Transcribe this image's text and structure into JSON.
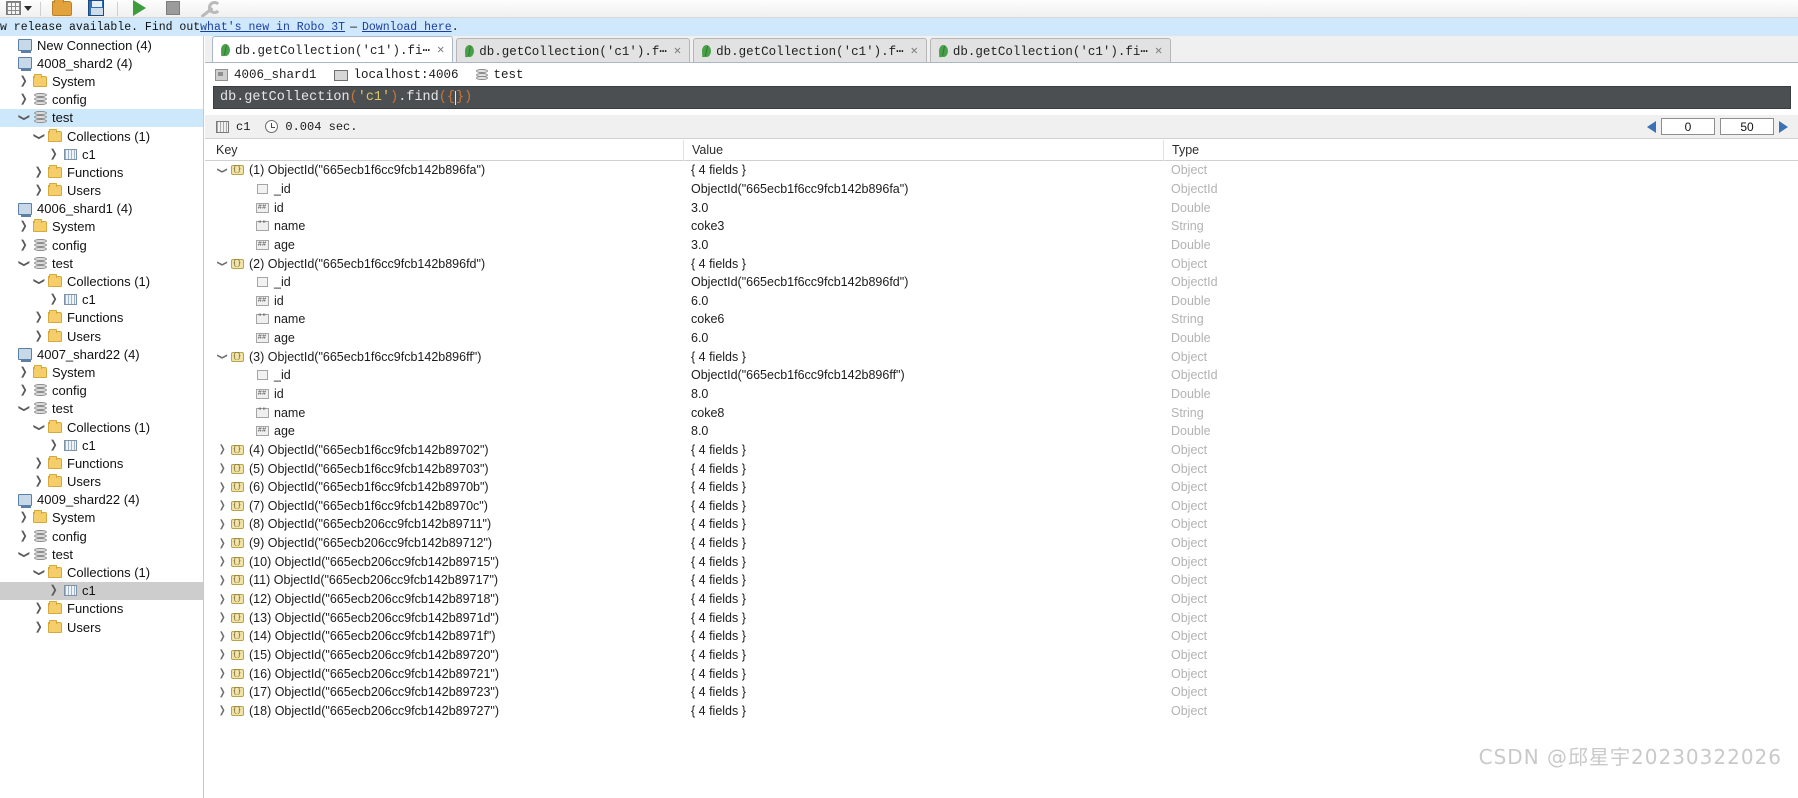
{
  "toolbar": {
    "buttons": [
      {
        "name": "grid-dropdown",
        "icon": "grid-icon"
      },
      {
        "name": "open-file",
        "icon": "folder-icon"
      },
      {
        "name": "save-file",
        "icon": "save-icon"
      },
      {
        "name": "execute-query",
        "icon": "play-icon"
      },
      {
        "name": "stop-query",
        "icon": "stop-icon"
      },
      {
        "name": "settings",
        "icon": "wrench-icon"
      }
    ]
  },
  "notification": {
    "prefix": "w release available. Find out ",
    "link1": "what's new in Robo 3T",
    "dash": "—",
    "link2": "Download here",
    "suffix": ".",
    "background": "#cfe8fb"
  },
  "sidebar": {
    "items": [
      {
        "label": "New Connection (4)",
        "icon": "server-icon",
        "depth": 0,
        "twisty": "none",
        "selected": false
      },
      {
        "label": "4008_shard2 (4)",
        "icon": "server-icon",
        "depth": 0,
        "twisty": "none",
        "selected": false
      },
      {
        "label": "System",
        "icon": "folder-icon",
        "depth": 1,
        "twisty": "closed",
        "selected": false
      },
      {
        "label": "config",
        "icon": "database-icon",
        "depth": 1,
        "twisty": "closed",
        "selected": false
      },
      {
        "label": "test",
        "icon": "database-icon",
        "depth": 1,
        "twisty": "open",
        "selected": true
      },
      {
        "label": "Collections (1)",
        "icon": "folder-icon",
        "depth": 2,
        "twisty": "open",
        "selected": false
      },
      {
        "label": "c1",
        "icon": "collection-icon",
        "depth": 3,
        "twisty": "closed",
        "selected": false
      },
      {
        "label": "Functions",
        "icon": "folder-icon",
        "depth": 2,
        "twisty": "closed",
        "selected": false
      },
      {
        "label": "Users",
        "icon": "folder-icon",
        "depth": 2,
        "twisty": "closed",
        "selected": false
      },
      {
        "label": "4006_shard1 (4)",
        "icon": "server-icon",
        "depth": 0,
        "twisty": "none",
        "selected": false
      },
      {
        "label": "System",
        "icon": "folder-icon",
        "depth": 1,
        "twisty": "closed",
        "selected": false
      },
      {
        "label": "config",
        "icon": "database-icon",
        "depth": 1,
        "twisty": "closed",
        "selected": false
      },
      {
        "label": "test",
        "icon": "database-icon",
        "depth": 1,
        "twisty": "open",
        "selected": false
      },
      {
        "label": "Collections (1)",
        "icon": "folder-icon",
        "depth": 2,
        "twisty": "open",
        "selected": false
      },
      {
        "label": "c1",
        "icon": "collection-icon",
        "depth": 3,
        "twisty": "closed",
        "selected": false
      },
      {
        "label": "Functions",
        "icon": "folder-icon",
        "depth": 2,
        "twisty": "closed",
        "selected": false
      },
      {
        "label": "Users",
        "icon": "folder-icon",
        "depth": 2,
        "twisty": "closed",
        "selected": false
      },
      {
        "label": "4007_shard22 (4)",
        "icon": "server-icon",
        "depth": 0,
        "twisty": "none",
        "selected": false
      },
      {
        "label": "System",
        "icon": "folder-icon",
        "depth": 1,
        "twisty": "closed",
        "selected": false
      },
      {
        "label": "config",
        "icon": "database-icon",
        "depth": 1,
        "twisty": "closed",
        "selected": false
      },
      {
        "label": "test",
        "icon": "database-icon",
        "depth": 1,
        "twisty": "open",
        "selected": false
      },
      {
        "label": "Collections (1)",
        "icon": "folder-icon",
        "depth": 2,
        "twisty": "open",
        "selected": false
      },
      {
        "label": "c1",
        "icon": "collection-icon",
        "depth": 3,
        "twisty": "closed",
        "selected": false
      },
      {
        "label": "Functions",
        "icon": "folder-icon",
        "depth": 2,
        "twisty": "closed",
        "selected": false
      },
      {
        "label": "Users",
        "icon": "folder-icon",
        "depth": 2,
        "twisty": "closed",
        "selected": false
      },
      {
        "label": "4009_shard22 (4)",
        "icon": "server-icon",
        "depth": 0,
        "twisty": "none",
        "selected": false
      },
      {
        "label": "System",
        "icon": "folder-icon",
        "depth": 1,
        "twisty": "closed",
        "selected": false
      },
      {
        "label": "config",
        "icon": "database-icon",
        "depth": 1,
        "twisty": "closed",
        "selected": false
      },
      {
        "label": "test",
        "icon": "database-icon",
        "depth": 1,
        "twisty": "open",
        "selected": false
      },
      {
        "label": "Collections (1)",
        "icon": "folder-icon",
        "depth": 2,
        "twisty": "open",
        "selected": false
      },
      {
        "label": "c1",
        "icon": "collection-icon",
        "depth": 3,
        "twisty": "closed",
        "selected": "gray"
      },
      {
        "label": "Functions",
        "icon": "folder-icon",
        "depth": 2,
        "twisty": "closed",
        "selected": false
      },
      {
        "label": "Users",
        "icon": "folder-icon",
        "depth": 2,
        "twisty": "closed",
        "selected": false
      }
    ]
  },
  "tabs": [
    {
      "label": "db.getCollection('c1').fi⋯",
      "active": true,
      "close": "✕"
    },
    {
      "label": "db.getCollection('c1').f⋯",
      "active": false,
      "close": "✕"
    },
    {
      "label": "db.getCollection('c1').f⋯",
      "active": false,
      "close": "✕"
    },
    {
      "label": "db.getCollection('c1').fi⋯",
      "active": false,
      "close": "✕"
    }
  ],
  "breadcrumb": {
    "shard": "4006_shard1",
    "host": "localhost:4006",
    "database": "test"
  },
  "editor": {
    "part_db": "db.getCollection",
    "part_open": "(",
    "part_str": "'c1'",
    "part_close": ")",
    "part_find": ".find",
    "part_paren_open": "(",
    "part_brace_open": "{",
    "part_brace_close": "}",
    "part_paren_close": ")",
    "full_text": "db.getCollection('c1').find({})"
  },
  "result_bar": {
    "collection": "c1",
    "time": "0.004 sec.",
    "page_start": "0",
    "page_size": "50"
  },
  "grid": {
    "columns": [
      "Key",
      "Value",
      "Type"
    ],
    "rows": [
      {
        "indent": 0,
        "twisty": "open",
        "icon": "object-icon",
        "key": "(1) ObjectId(\"665ecb1f6cc9fcb142b896fa\")",
        "value": "{ 4 fields }",
        "type": "Object"
      },
      {
        "indent": 1,
        "twisty": "none",
        "icon": "objectid-icon",
        "key": "_id",
        "value": "ObjectId(\"665ecb1f6cc9fcb142b896fa\")",
        "type": "ObjectId"
      },
      {
        "indent": 1,
        "twisty": "none",
        "icon": "number-icon",
        "key": "id",
        "value": "3.0",
        "type": "Double"
      },
      {
        "indent": 1,
        "twisty": "none",
        "icon": "string-icon",
        "key": "name",
        "value": "coke3",
        "type": "String"
      },
      {
        "indent": 1,
        "twisty": "none",
        "icon": "number-icon",
        "key": "age",
        "value": "3.0",
        "type": "Double"
      },
      {
        "indent": 0,
        "twisty": "open",
        "icon": "object-icon",
        "key": "(2) ObjectId(\"665ecb1f6cc9fcb142b896fd\")",
        "value": "{ 4 fields }",
        "type": "Object"
      },
      {
        "indent": 1,
        "twisty": "none",
        "icon": "objectid-icon",
        "key": "_id",
        "value": "ObjectId(\"665ecb1f6cc9fcb142b896fd\")",
        "type": "ObjectId"
      },
      {
        "indent": 1,
        "twisty": "none",
        "icon": "number-icon",
        "key": "id",
        "value": "6.0",
        "type": "Double"
      },
      {
        "indent": 1,
        "twisty": "none",
        "icon": "string-icon",
        "key": "name",
        "value": "coke6",
        "type": "String"
      },
      {
        "indent": 1,
        "twisty": "none",
        "icon": "number-icon",
        "key": "age",
        "value": "6.0",
        "type": "Double"
      },
      {
        "indent": 0,
        "twisty": "open",
        "icon": "object-icon",
        "key": "(3) ObjectId(\"665ecb1f6cc9fcb142b896ff\")",
        "value": "{ 4 fields }",
        "type": "Object"
      },
      {
        "indent": 1,
        "twisty": "none",
        "icon": "objectid-icon",
        "key": "_id",
        "value": "ObjectId(\"665ecb1f6cc9fcb142b896ff\")",
        "type": "ObjectId"
      },
      {
        "indent": 1,
        "twisty": "none",
        "icon": "number-icon",
        "key": "id",
        "value": "8.0",
        "type": "Double"
      },
      {
        "indent": 1,
        "twisty": "none",
        "icon": "string-icon",
        "key": "name",
        "value": "coke8",
        "type": "String"
      },
      {
        "indent": 1,
        "twisty": "none",
        "icon": "number-icon",
        "key": "age",
        "value": "8.0",
        "type": "Double"
      },
      {
        "indent": 0,
        "twisty": "closed",
        "icon": "object-icon",
        "key": "(4) ObjectId(\"665ecb1f6cc9fcb142b89702\")",
        "value": "{ 4 fields }",
        "type": "Object"
      },
      {
        "indent": 0,
        "twisty": "closed",
        "icon": "object-icon",
        "key": "(5) ObjectId(\"665ecb1f6cc9fcb142b89703\")",
        "value": "{ 4 fields }",
        "type": "Object"
      },
      {
        "indent": 0,
        "twisty": "closed",
        "icon": "object-icon",
        "key": "(6) ObjectId(\"665ecb1f6cc9fcb142b8970b\")",
        "value": "{ 4 fields }",
        "type": "Object"
      },
      {
        "indent": 0,
        "twisty": "closed",
        "icon": "object-icon",
        "key": "(7) ObjectId(\"665ecb1f6cc9fcb142b8970c\")",
        "value": "{ 4 fields }",
        "type": "Object"
      },
      {
        "indent": 0,
        "twisty": "closed",
        "icon": "object-icon",
        "key": "(8) ObjectId(\"665ecb206cc9fcb142b89711\")",
        "value": "{ 4 fields }",
        "type": "Object"
      },
      {
        "indent": 0,
        "twisty": "closed",
        "icon": "object-icon",
        "key": "(9) ObjectId(\"665ecb206cc9fcb142b89712\")",
        "value": "{ 4 fields }",
        "type": "Object"
      },
      {
        "indent": 0,
        "twisty": "closed",
        "icon": "object-icon",
        "key": "(10) ObjectId(\"665ecb206cc9fcb142b89715\")",
        "value": "{ 4 fields }",
        "type": "Object"
      },
      {
        "indent": 0,
        "twisty": "closed",
        "icon": "object-icon",
        "key": "(11) ObjectId(\"665ecb206cc9fcb142b89717\")",
        "value": "{ 4 fields }",
        "type": "Object"
      },
      {
        "indent": 0,
        "twisty": "closed",
        "icon": "object-icon",
        "key": "(12) ObjectId(\"665ecb206cc9fcb142b89718\")",
        "value": "{ 4 fields }",
        "type": "Object"
      },
      {
        "indent": 0,
        "twisty": "closed",
        "icon": "object-icon",
        "key": "(13) ObjectId(\"665ecb206cc9fcb142b8971d\")",
        "value": "{ 4 fields }",
        "type": "Object"
      },
      {
        "indent": 0,
        "twisty": "closed",
        "icon": "object-icon",
        "key": "(14) ObjectId(\"665ecb206cc9fcb142b8971f\")",
        "value": "{ 4 fields }",
        "type": "Object"
      },
      {
        "indent": 0,
        "twisty": "closed",
        "icon": "object-icon",
        "key": "(15) ObjectId(\"665ecb206cc9fcb142b89720\")",
        "value": "{ 4 fields }",
        "type": "Object"
      },
      {
        "indent": 0,
        "twisty": "closed",
        "icon": "object-icon",
        "key": "(16) ObjectId(\"665ecb206cc9fcb142b89721\")",
        "value": "{ 4 fields }",
        "type": "Object"
      },
      {
        "indent": 0,
        "twisty": "closed",
        "icon": "object-icon",
        "key": "(17) ObjectId(\"665ecb206cc9fcb142b89723\")",
        "value": "{ 4 fields }",
        "type": "Object"
      },
      {
        "indent": 0,
        "twisty": "closed",
        "icon": "object-icon",
        "key": "(18) ObjectId(\"665ecb206cc9fcb142b89727\")",
        "value": "{ 4 fields }",
        "type": "Object"
      }
    ]
  },
  "watermark": "CSDN @邱星宇20230322026"
}
